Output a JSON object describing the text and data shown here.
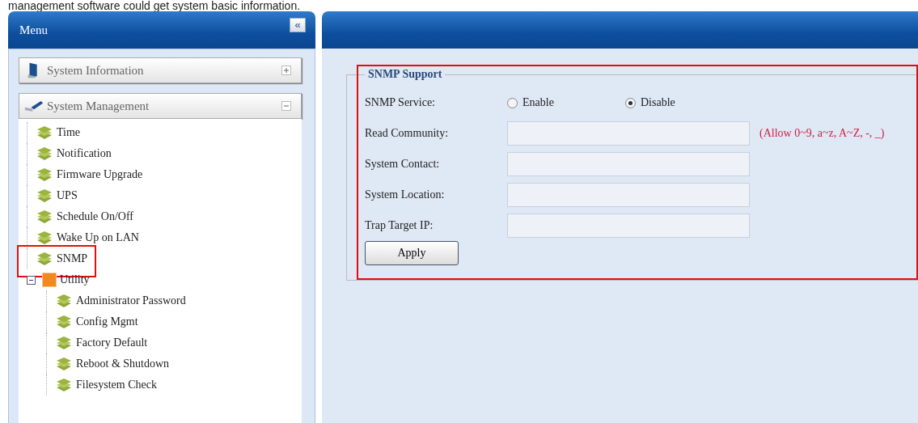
{
  "caption": "management software could get system basic information.",
  "menu": {
    "title": "Menu",
    "collapse": "«"
  },
  "sections": [
    {
      "label": "System Information",
      "kind": "info",
      "expanded": false
    },
    {
      "label": "System Management",
      "kind": "manage",
      "expanded": true,
      "items": [
        {
          "label": "Time",
          "kind": "page",
          "highlighted": false
        },
        {
          "label": "Notification",
          "kind": "page",
          "highlighted": false
        },
        {
          "label": "Firmware Upgrade",
          "kind": "page",
          "highlighted": false
        },
        {
          "label": "UPS",
          "kind": "page",
          "highlighted": false
        },
        {
          "label": "Schedule On/Off",
          "kind": "page",
          "highlighted": false
        },
        {
          "label": "Wake Up on LAN",
          "kind": "page",
          "highlighted": false
        },
        {
          "label": "SNMP",
          "kind": "page",
          "highlighted": true
        },
        {
          "label": "Utility",
          "kind": "folder",
          "expanded": true,
          "children": [
            {
              "label": "Administrator Password",
              "kind": "page",
              "highlighted": false
            },
            {
              "label": "Config Mgmt",
              "kind": "page",
              "highlighted": false
            },
            {
              "label": "Factory Default",
              "kind": "page",
              "highlighted": false
            },
            {
              "label": "Reboot & Shutdown",
              "kind": "page",
              "highlighted": false
            },
            {
              "label": "Filesystem Check",
              "kind": "page",
              "highlighted": false
            }
          ]
        }
      ]
    }
  ],
  "form": {
    "legend": "SNMP Support",
    "highlighted": true,
    "service": {
      "label": "SNMP Service:",
      "options": [
        {
          "label": "Enable",
          "selected": false
        },
        {
          "label": "Disable",
          "selected": true
        }
      ]
    },
    "fields": [
      {
        "label": "Read Community:",
        "hint": "(Allow 0~9, a~z, A~Z, -, _)"
      },
      {
        "label": "System Contact:"
      },
      {
        "label": "System Location:"
      },
      {
        "label": "Trap Target IP:"
      }
    ],
    "apply": "Apply"
  }
}
